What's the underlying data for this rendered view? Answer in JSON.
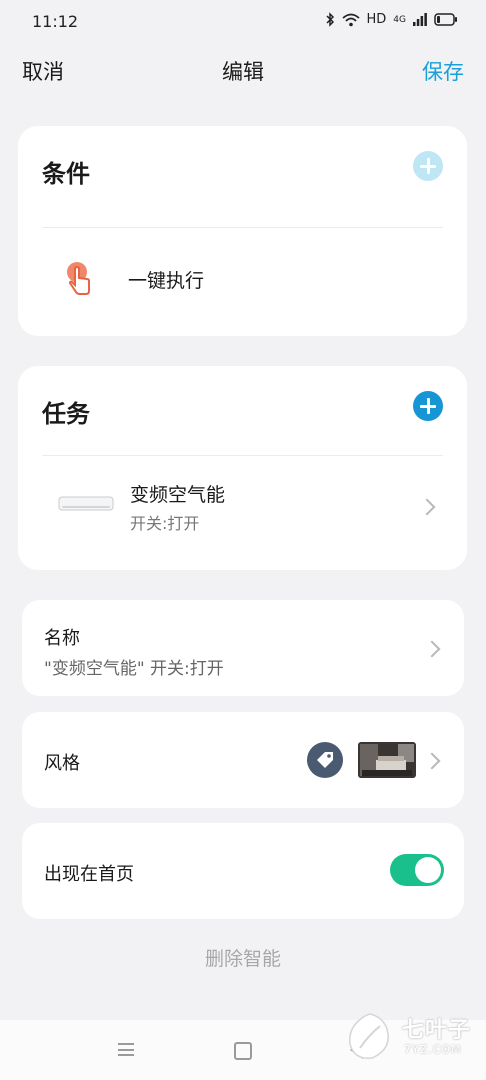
{
  "status_bar": {
    "time": "11:12",
    "hd": "HD",
    "net": "4G",
    "icons": [
      "bluetooth-icon",
      "wifi-icon",
      "signal-icon",
      "battery-icon"
    ]
  },
  "header": {
    "cancel": "取消",
    "title": "编辑",
    "save": "保存",
    "save_color": "#1aa0d9"
  },
  "conditions": {
    "title": "条件",
    "add_icon": "plus-circle-icon",
    "add_color": "#bfe6f5",
    "items": [
      {
        "icon": "tap-hand-icon",
        "label": "一键执行"
      }
    ]
  },
  "tasks": {
    "title": "任务",
    "add_icon": "plus-circle-icon",
    "add_color": "#1696d4",
    "items": [
      {
        "icon": "air-conditioner-icon",
        "name": "变频空气能",
        "action": "开关:打开"
      }
    ]
  },
  "name": {
    "label": "名称",
    "value": "\"变频空气能\" 开关:打开"
  },
  "style": {
    "label": "风格",
    "tag_icon": "tag-icon",
    "thumbnail": "bedroom-thumbnail"
  },
  "show_on_home": {
    "label": "出现在首页",
    "enabled": true,
    "toggle_color": "#19c08b"
  },
  "delete_label": "删除智能",
  "watermark": {
    "text": "七叶子",
    "sub": "7YZ.COM"
  }
}
